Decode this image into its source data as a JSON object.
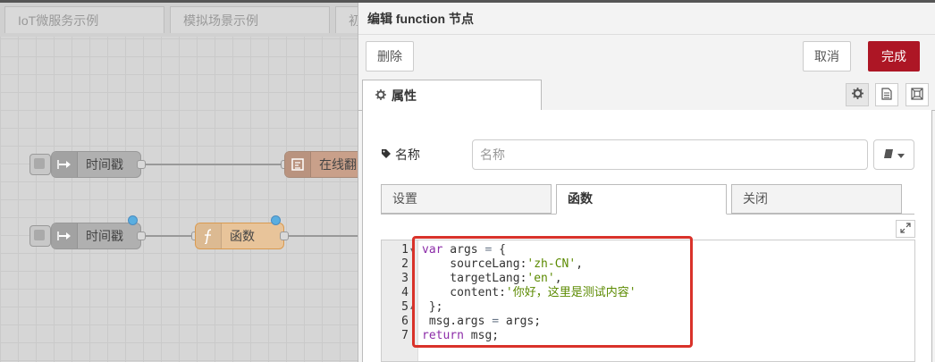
{
  "workspace": {
    "tabs": [
      "IoT微服务示例",
      "模拟场景示例",
      "初"
    ],
    "nodes": {
      "inject1": "时间戳",
      "translate": "在线翻",
      "inject2": "时间戳",
      "function": "函数"
    }
  },
  "dialog": {
    "title": "编辑 function 节点",
    "delete_label": "删除",
    "cancel_label": "取消",
    "done_label": "完成",
    "properties_tab": "属性",
    "name_label": "名称",
    "name_placeholder": "名称",
    "subtabs": [
      "设置",
      "函数",
      "关闭"
    ],
    "code": {
      "line_numbers": [
        "1",
        "2",
        "3",
        "4",
        "5",
        "6",
        "7"
      ],
      "lines": [
        {
          "pre": "",
          "kw": "var",
          "mid": " args ",
          "op": "=",
          "post": " {",
          "str": "",
          "tail": ""
        },
        {
          "pre": "    sourceLang:",
          "kw": "",
          "mid": "",
          "op": "",
          "post": "",
          "str": "'zh-CN'",
          "tail": ","
        },
        {
          "pre": "    targetLang:",
          "kw": "",
          "mid": "",
          "op": "",
          "post": "",
          "str": "'en'",
          "tail": ","
        },
        {
          "pre": "    content:",
          "kw": "",
          "mid": "",
          "op": "",
          "post": "",
          "str": "'你好，这里是测试内容'",
          "tail": ""
        },
        {
          "pre": " };",
          "kw": "",
          "mid": "",
          "op": "",
          "post": "",
          "str": "",
          "tail": ""
        },
        {
          "pre": " msg.args ",
          "kw": "",
          "mid": "",
          "op": "=",
          "post": " args;",
          "str": "",
          "tail": ""
        },
        {
          "pre": "",
          "kw": "return",
          "mid": " msg;",
          "op": "",
          "post": "",
          "str": "",
          "tail": ""
        }
      ]
    }
  },
  "colors": {
    "primary": "#ad1625",
    "highlight": "#d9322a",
    "keyword": "#8c2ca8",
    "string": "#5b8a00"
  }
}
